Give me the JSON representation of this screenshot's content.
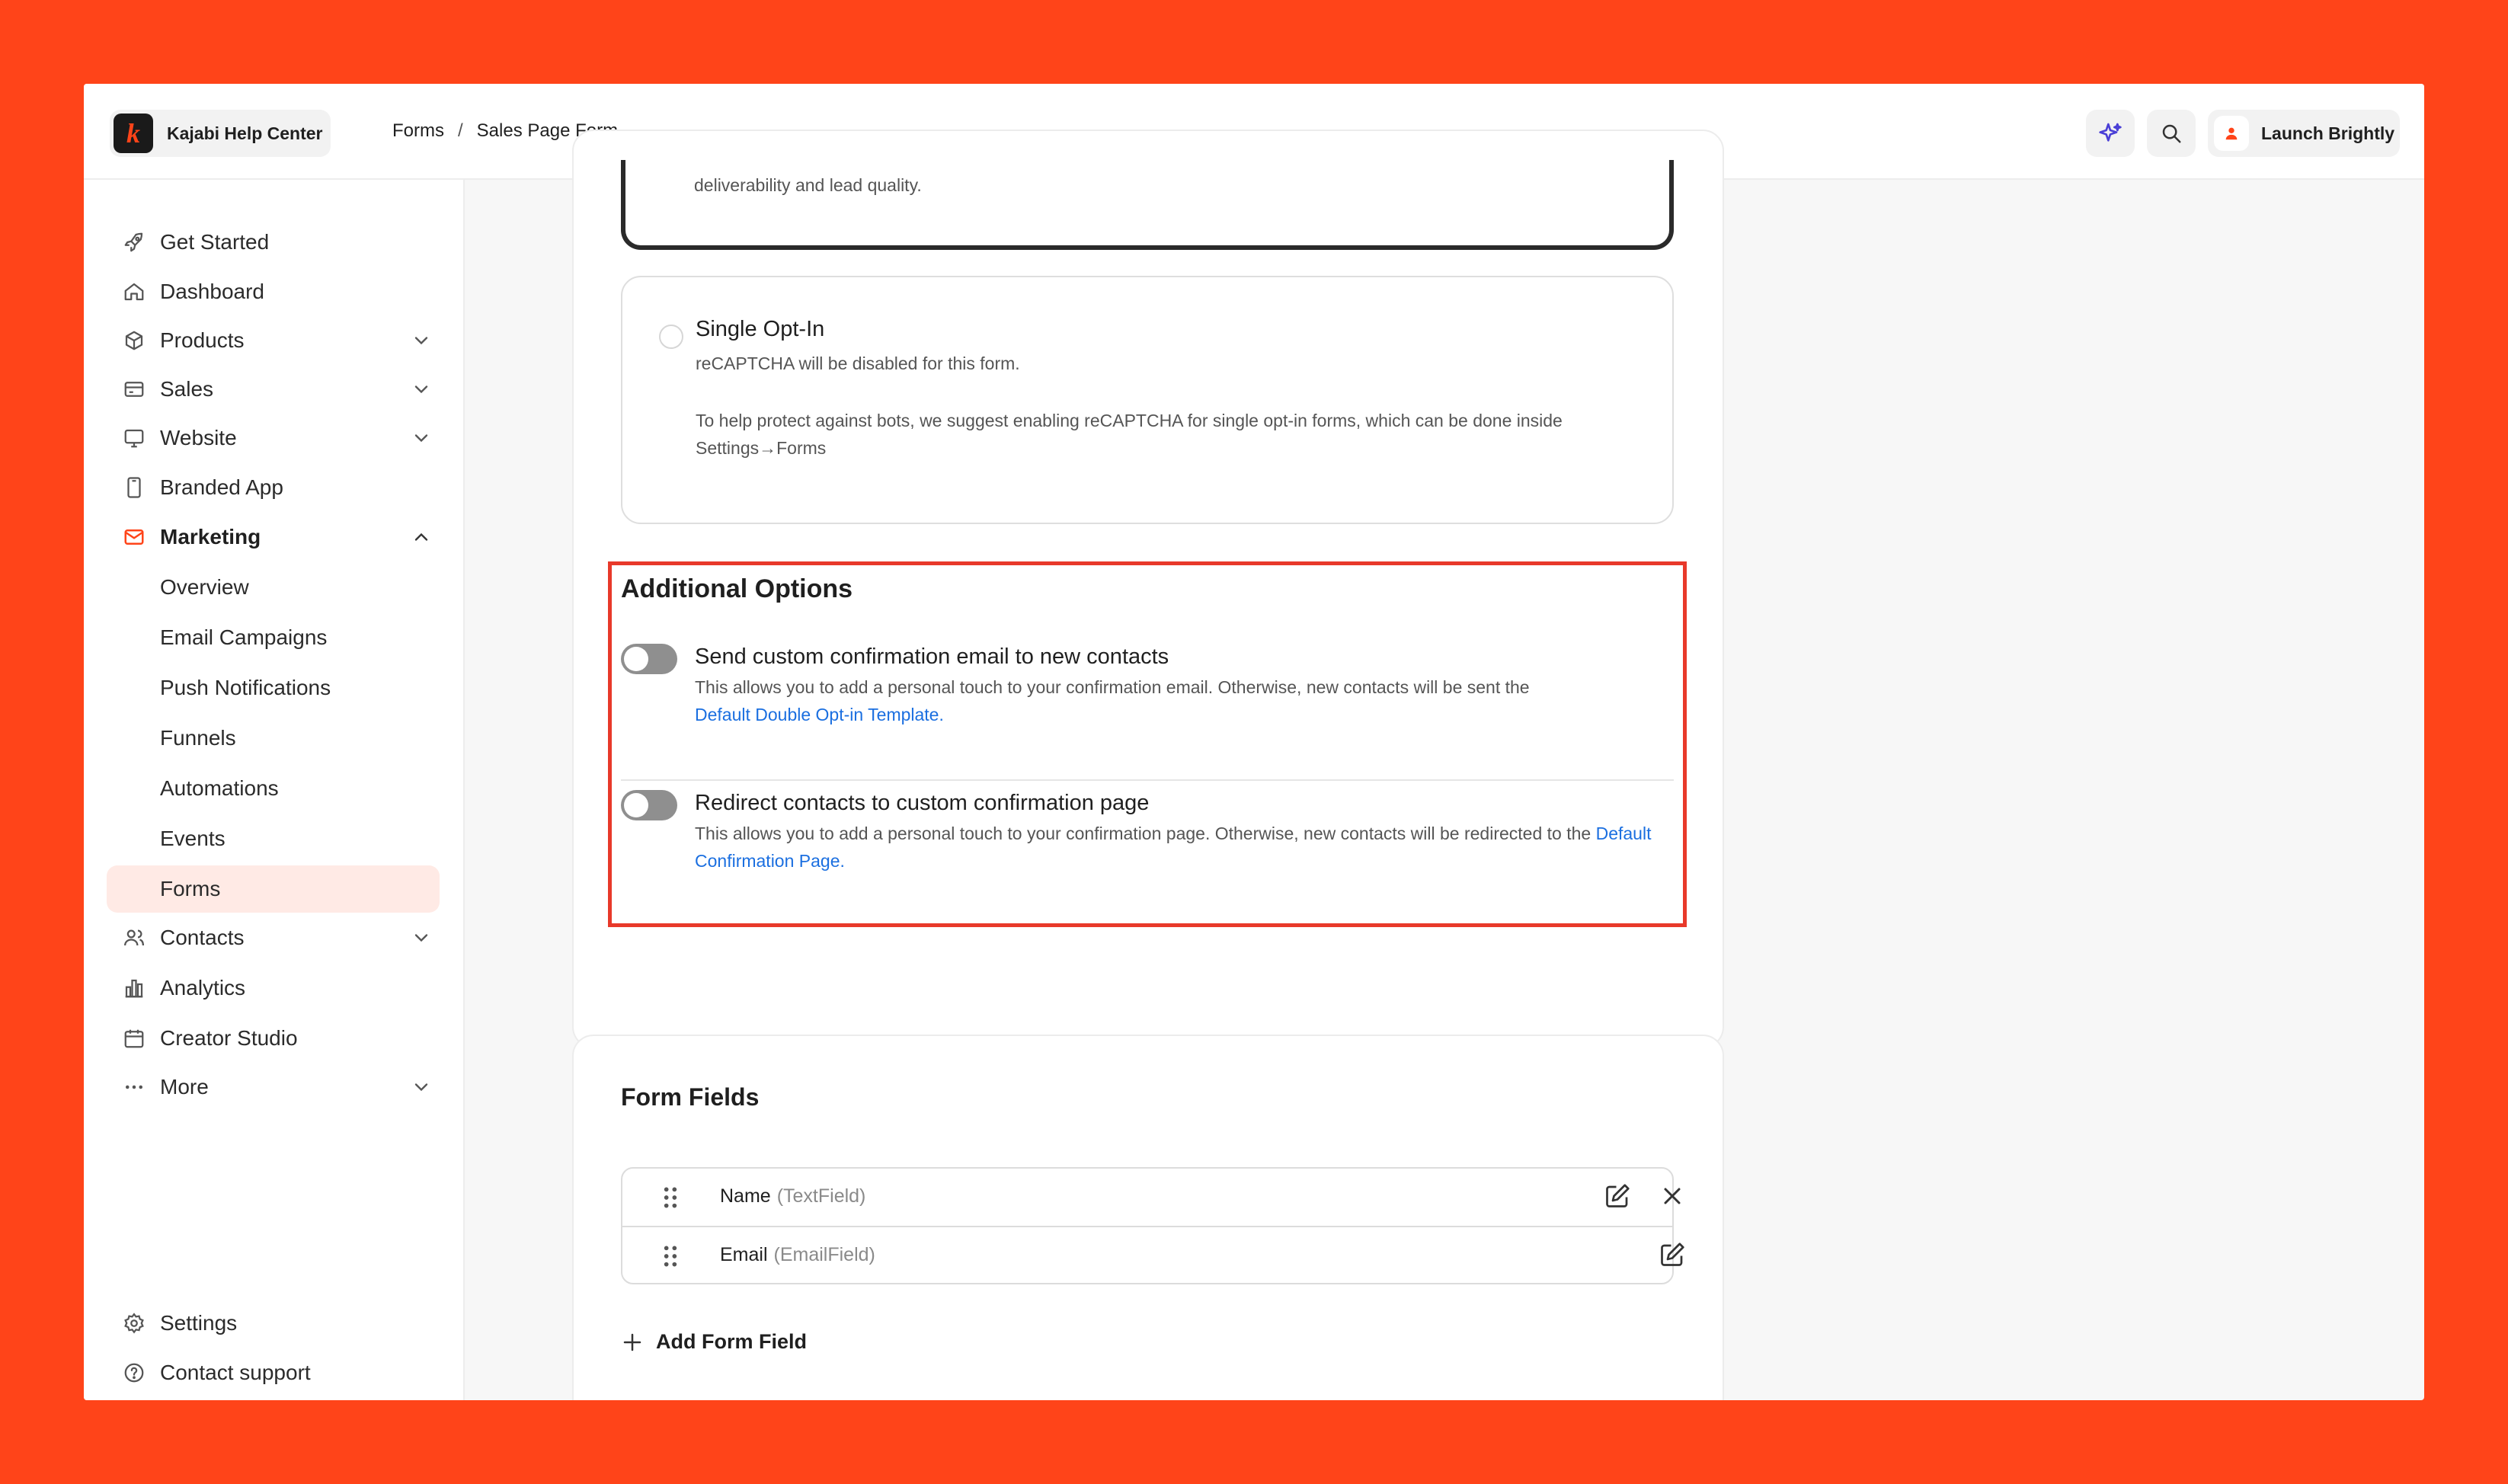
{
  "app": {
    "brand": "Kajabi Help Center",
    "brand_mark": "k",
    "account": "Launch Brightly"
  },
  "breadcrumb": {
    "items": [
      "Forms",
      "Sales Page Form"
    ],
    "separator": "/"
  },
  "sidebar": {
    "items": [
      {
        "label": "Get Started",
        "icon": "rocket-icon"
      },
      {
        "label": "Dashboard",
        "icon": "home-icon"
      },
      {
        "label": "Products",
        "icon": "box-icon",
        "expandable": true
      },
      {
        "label": "Sales",
        "icon": "card-icon",
        "expandable": true
      },
      {
        "label": "Website",
        "icon": "monitor-icon",
        "expandable": true
      },
      {
        "label": "Branded App",
        "icon": "phone-icon"
      },
      {
        "label": "Marketing",
        "icon": "mail-icon",
        "expandable": true,
        "open": true
      },
      {
        "label": "Overview"
      },
      {
        "label": "Email Campaigns"
      },
      {
        "label": "Push Notifications"
      },
      {
        "label": "Funnels"
      },
      {
        "label": "Automations"
      },
      {
        "label": "Events"
      },
      {
        "label": "Forms",
        "active": true
      },
      {
        "label": "Contacts",
        "icon": "users-icon",
        "expandable": true
      },
      {
        "label": "Analytics",
        "icon": "bar-chart-icon"
      },
      {
        "label": "Creator Studio",
        "icon": "calendar-icon"
      },
      {
        "label": "More",
        "icon": "dots-icon",
        "expandable": true
      }
    ],
    "footer": [
      {
        "label": "Settings",
        "icon": "gear-icon"
      },
      {
        "label": "Contact support",
        "icon": "help-icon"
      }
    ]
  },
  "optin": {
    "double_desc": "deliverability and lead quality.",
    "single_title": "Single Opt-In",
    "single_sub": "reCAPTCHA will be disabled for this form.",
    "single_note": "To help protect against bots, we suggest enabling reCAPTCHA for single opt-in forms, which can be done inside Settings→Forms"
  },
  "additional": {
    "title": "Additional Options",
    "options": [
      {
        "title": "Send custom confirmation email to new contacts",
        "desc": "This allows you to add a personal touch to your confirmation email. Otherwise, new contacts will be sent the",
        "link": "Default Double Opt-in Template.",
        "enabled": false
      },
      {
        "title": "Redirect contacts to custom confirmation page",
        "desc": "This allows you to add a personal touch to your confirmation page. Otherwise, new contacts will be redirected to the",
        "link": "Default Confirmation Page.",
        "enabled": false
      }
    ]
  },
  "form_fields": {
    "title": "Form Fields",
    "rows": [
      {
        "name": "Name",
        "type": "(TextField)"
      },
      {
        "name": "Email",
        "type": "(EmailField)"
      }
    ],
    "add_label": "Add Form Field"
  },
  "colors": {
    "accent": "#ff4419",
    "link": "#1b6fe0",
    "highlight": "#e8392a"
  }
}
